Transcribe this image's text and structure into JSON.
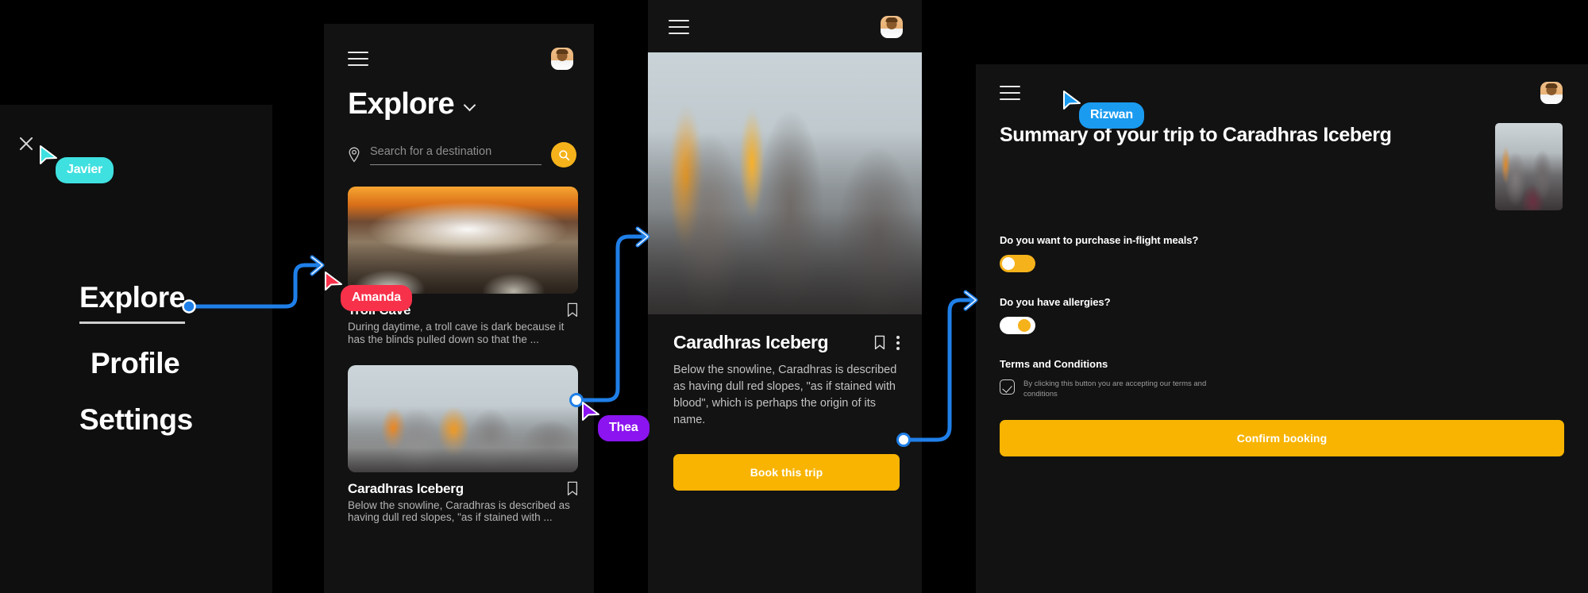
{
  "meta": {
    "tool": "design-prototype-canvas",
    "canvas_background": "#000000",
    "accent_amber": "#F5B21B",
    "wire_blue": "#1F7FE8"
  },
  "collaborators": [
    {
      "name": "Javier",
      "color": "#3FE0E0"
    },
    {
      "name": "Amanda",
      "color": "#F8314A"
    },
    {
      "name": "Thea",
      "color": "#8B14F0"
    },
    {
      "name": "Rizwan",
      "color": "#1A9BF0"
    }
  ],
  "frames": {
    "menu": {
      "close_icon": "close-icon",
      "items": [
        {
          "label": "Explore",
          "active": true
        },
        {
          "label": "Profile",
          "active": false
        },
        {
          "label": "Settings",
          "active": false
        }
      ]
    },
    "explore": {
      "menu_icon": "hamburger-icon",
      "avatar_icon": "avatar",
      "title": "Explore",
      "title_chevron": "chevron-down-icon",
      "search": {
        "pin_icon": "location-pin-icon",
        "placeholder": "Search for a destination",
        "button_icon": "search-icon"
      },
      "cards": [
        {
          "title": "Troll Cave",
          "desc": "During daytime, a troll cave is dark because it has the blinds pulled down so that the ...",
          "bookmark_icon": "bookmark-icon",
          "photo": "canyon"
        },
        {
          "title": "Caradhras Iceberg",
          "desc": "Below the snowline, Caradhras is described as having dull red slopes, \"as if stained with ...",
          "bookmark_icon": "bookmark-icon",
          "photo": "peaks"
        }
      ]
    },
    "detail": {
      "menu_icon": "hamburger-icon",
      "avatar_icon": "avatar",
      "hero_photo": "hero-peaks",
      "title": "Caradhras Iceberg",
      "bookmark_icon": "bookmark-icon",
      "more_icon": "kebab-menu-icon",
      "description": "Below the snowline, Caradhras is described as having dull red slopes, \"as if stained with blood\", which is perhaps the origin of its name.",
      "cta_label": "Book this trip"
    },
    "summary": {
      "menu_icon": "hamburger-icon",
      "avatar_icon": "avatar",
      "title": "Summary of your trip to Caradhras Iceberg",
      "thumb_photo": "thumb-peaks",
      "questions": [
        {
          "label": "Do you want to purchase in-flight meals?",
          "state": "off"
        },
        {
          "label": "Do you have allergies?",
          "state": "on"
        }
      ],
      "terms": {
        "heading": "Terms and Conditions",
        "checkbox_icon": "checkbox-checked-icon",
        "checked": true,
        "text": "By clicking this button you are accepting our terms and conditions"
      },
      "cta_label": "Confirm booking"
    }
  }
}
